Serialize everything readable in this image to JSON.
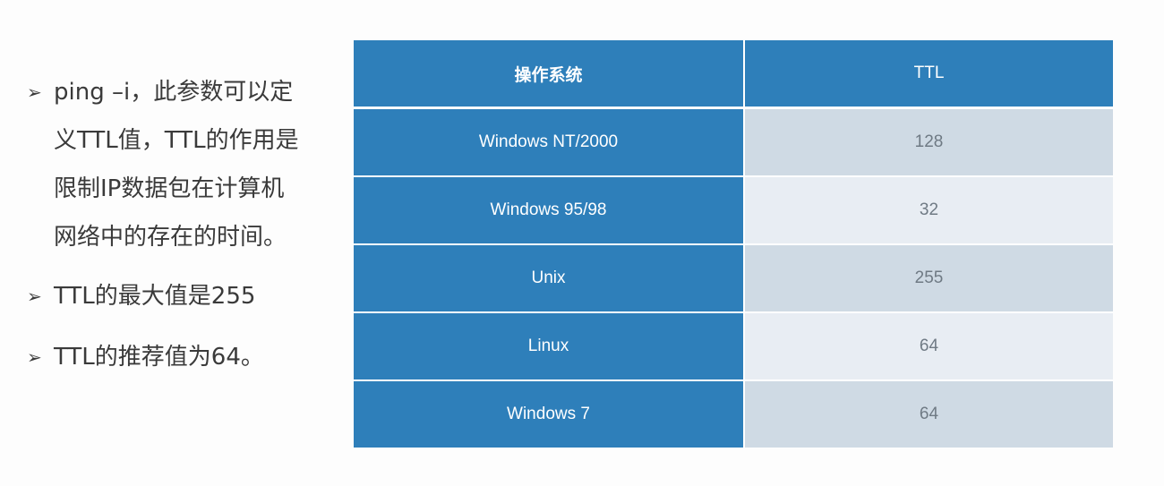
{
  "bullets": [
    {
      "arrow": "➢",
      "text": "ping –i，此参数可以定义TTL值，TTL的作用是限制IP数据包在计算机网络中的存在的时间。"
    },
    {
      "arrow": "➢",
      "text": "TTL的最大值是255"
    },
    {
      "arrow": "➢",
      "text": "TTL的推荐值为64。"
    }
  ],
  "table": {
    "headers": {
      "os": "操作系统",
      "ttl": "TTL"
    },
    "rows": [
      {
        "os": "Windows NT/2000",
        "ttl": "128"
      },
      {
        "os": "Windows 95/98",
        "ttl": "32"
      },
      {
        "os": "Unix",
        "ttl": "255"
      },
      {
        "os": "Linux",
        "ttl": "64"
      },
      {
        "os": "Windows 7",
        "ttl": "64"
      }
    ]
  },
  "colors": {
    "header_blue": "#2e7fba",
    "row_light_1": "#cfdae4",
    "row_light_2": "#e8edf3"
  }
}
